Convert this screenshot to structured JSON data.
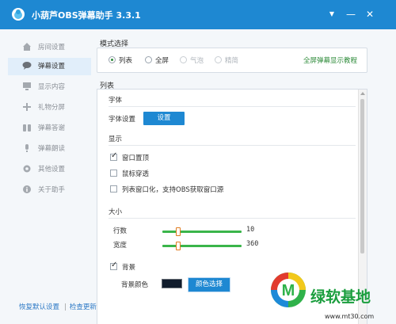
{
  "window": {
    "title": "小葫芦OBS弹幕助手  3.3.1",
    "controls": {
      "menu": "▼",
      "minimize": "—",
      "close": "✕"
    }
  },
  "sidebar": {
    "items": [
      {
        "label": "房间设置",
        "icon": "home-icon",
        "active": false
      },
      {
        "label": "弹幕设置",
        "icon": "speech-bubble-icon",
        "active": true
      },
      {
        "label": "显示内容",
        "icon": "monitor-icon",
        "active": false
      },
      {
        "label": "礼物分屏",
        "icon": "plus-icon",
        "active": false
      },
      {
        "label": "弹幕答谢",
        "icon": "hands-icon",
        "active": false
      },
      {
        "label": "弹幕朗读",
        "icon": "microphone-icon",
        "active": false
      },
      {
        "label": "其他设置",
        "icon": "gear-icon",
        "active": false
      },
      {
        "label": "关于助手",
        "icon": "info-icon",
        "active": false
      }
    ]
  },
  "footer": {
    "restore_default": "恢复默认设置",
    "separator": "|",
    "check_update": "检查更新"
  },
  "mode": {
    "title": "模式选择",
    "options": [
      {
        "label": "列表",
        "selected": true,
        "enabled": true
      },
      {
        "label": "全屏",
        "selected": false,
        "enabled": true
      },
      {
        "label": "气泡",
        "selected": false,
        "enabled": false
      },
      {
        "label": "精简",
        "selected": false,
        "enabled": false
      }
    ],
    "tutorial_link": "全屏弹幕显示教程"
  },
  "list": {
    "title": "列表",
    "font": {
      "heading": "字体",
      "setting_label": "字体设置",
      "setting_button": "设置"
    },
    "display": {
      "heading": "显示",
      "options": [
        {
          "label": "窗口置顶",
          "checked": true
        },
        {
          "label": "鼠标穿透",
          "checked": false
        },
        {
          "label": "列表窗口化，支持OBS获取窗口源",
          "checked": false
        }
      ]
    },
    "size": {
      "heading": "大小",
      "rows": {
        "label": "行数",
        "value": "10"
      },
      "width": {
        "label": "宽度",
        "value": "360"
      }
    },
    "background": {
      "label": "背景",
      "checked": true,
      "color_label": "背景颜色",
      "color_value": "#101c2c",
      "color_button": "颜色选择"
    }
  },
  "watermark": {
    "logo_letter": "M",
    "text": "绿软基地",
    "url": "www.mt30.com"
  },
  "colors": {
    "accent": "#1e88d2",
    "green": "#3ab54a",
    "link_green": "#2e8b3a"
  }
}
